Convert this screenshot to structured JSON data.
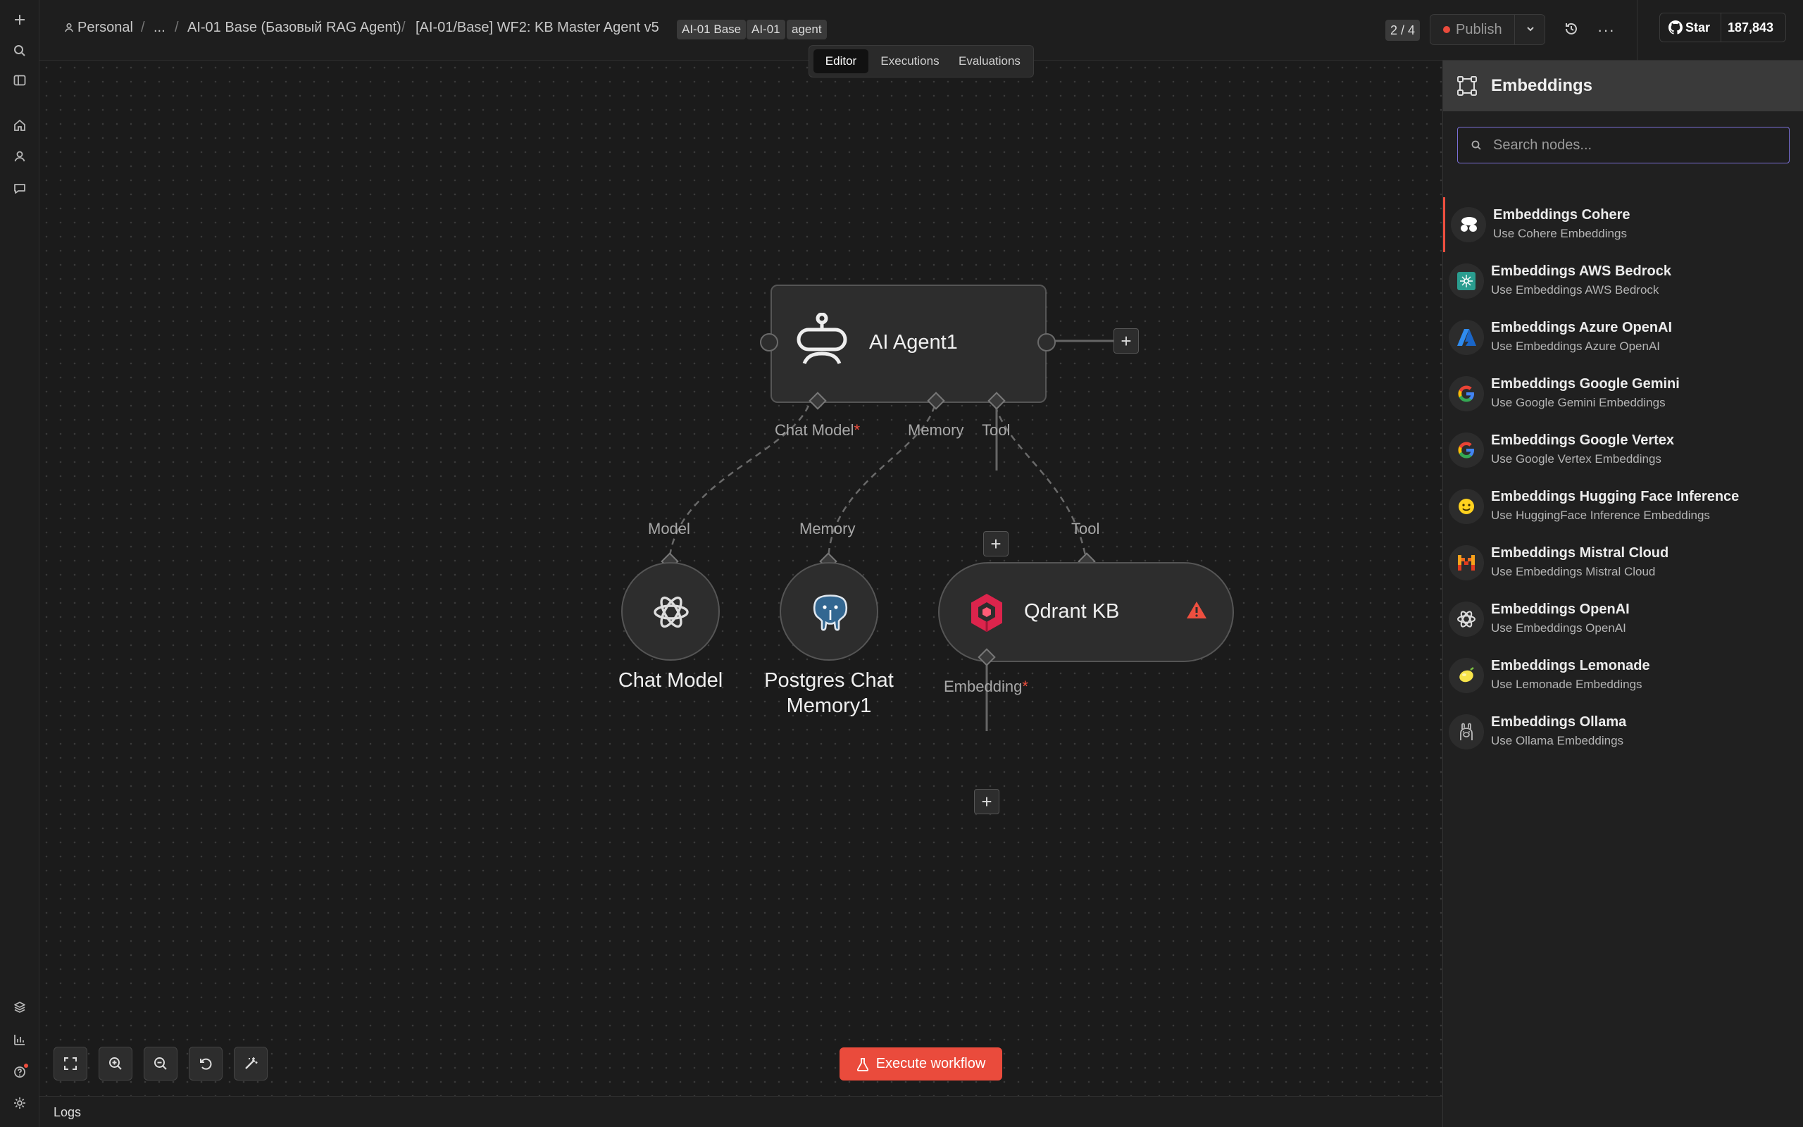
{
  "breadcrumb": {
    "project": "Personal",
    "ellipsis": "...",
    "folder": "AI-01 Base (Базовый RAG Agent)",
    "workflow": "[AI-01/Base] WF2: KB Master Agent v5"
  },
  "tags": [
    "AI-01 Base",
    "AI-01",
    "agent"
  ],
  "header": {
    "version": "2 / 4",
    "publish_label": "Publish",
    "star_label": "Star",
    "star_count": "187,843"
  },
  "tabs": [
    "Editor",
    "Executions",
    "Evaluations"
  ],
  "nodes": {
    "agent": {
      "title": "AI Agent1",
      "ports": {
        "chat_model": "Chat Model",
        "memory": "Memory",
        "tool": "Tool"
      }
    },
    "chat_model": {
      "title": "Chat Model",
      "port": "Model"
    },
    "memory": {
      "title": "Postgres Chat Memory1",
      "port": "Memory"
    },
    "qdrant": {
      "title": "Qdrant KB",
      "port": "Tool",
      "embedding_port": "Embedding"
    }
  },
  "execute_label": "Execute workflow",
  "logs_label": "Logs",
  "panel": {
    "title": "Embeddings",
    "search_placeholder": "Search nodes...",
    "items": [
      {
        "title": "Embeddings Cohere",
        "desc": "Use Cohere Embeddings",
        "icon": "cohere-icon"
      },
      {
        "title": "Embeddings AWS Bedrock",
        "desc": "Use Embeddings AWS Bedrock",
        "icon": "aws-bedrock-icon"
      },
      {
        "title": "Embeddings Azure OpenAI",
        "desc": "Use Embeddings Azure OpenAI",
        "icon": "azure-icon"
      },
      {
        "title": "Embeddings Google Gemini",
        "desc": "Use Google Gemini Embeddings",
        "icon": "google-icon"
      },
      {
        "title": "Embeddings Google Vertex",
        "desc": "Use Google Vertex Embeddings",
        "icon": "google-icon"
      },
      {
        "title": "Embeddings Hugging Face Inference",
        "desc": "Use HuggingFace Inference Embeddings",
        "icon": "huggingface-icon"
      },
      {
        "title": "Embeddings Mistral Cloud",
        "desc": "Use Embeddings Mistral Cloud",
        "icon": "mistral-icon"
      },
      {
        "title": "Embeddings OpenAI",
        "desc": "Use Embeddings OpenAI",
        "icon": "openai-icon"
      },
      {
        "title": "Embeddings Lemonade",
        "desc": "Use Lemonade Embeddings",
        "icon": "lemonade-icon"
      },
      {
        "title": "Embeddings Ollama",
        "desc": "Use Ollama Embeddings",
        "icon": "ollama-icon"
      }
    ]
  }
}
